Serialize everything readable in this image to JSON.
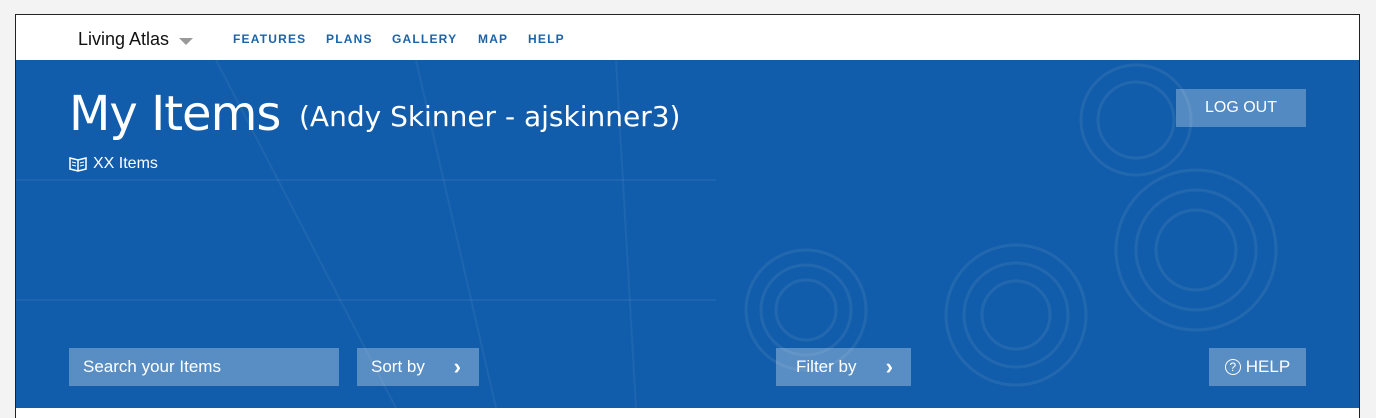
{
  "nav": {
    "brand": "Living Atlas",
    "links": [
      "FEATURES",
      "PLANS",
      "GALLERY",
      "MAP",
      "HELP"
    ]
  },
  "hero": {
    "title": "My Items",
    "user": "(Andy Skinner - ajskinner3)",
    "item_count": "XX Items",
    "logout_label": "LOG OUT"
  },
  "controls": {
    "search_placeholder": "Search your Items",
    "sort_label": "Sort by",
    "filter_label": "Filter by",
    "help_label": "HELP"
  },
  "colors": {
    "hero_blue": "#1565b4",
    "nav_link": "#1d63a6"
  },
  "icons": {
    "brand_caret": "chevron-down-icon",
    "items": "book-icon",
    "sort": "chevron-right-icon",
    "filter": "chevron-right-icon",
    "help": "question-circle-icon"
  }
}
